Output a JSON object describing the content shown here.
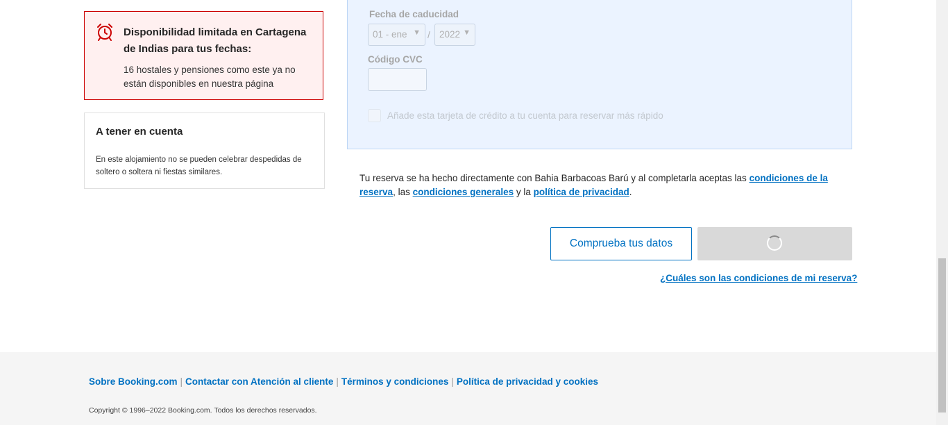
{
  "alert": {
    "icon": "alarm-clock-icon",
    "title": "Disponibilidad limitada en Cartagena de Indias para tus fechas:",
    "text": "16 hostales y pensiones como este ya no están disponibles en nuestra página",
    "color": "#cc0000"
  },
  "notice": {
    "title": "A tener en cuenta",
    "text": "En este alojamiento no se pueden celebrar despedidas de soltero o soltera ni fiestas similares."
  },
  "payment": {
    "expiry_label": "Fecha de caducidad",
    "month_value": "01 - ene",
    "year_value": "2022",
    "separator": "/",
    "cvc_label": "Código CVC",
    "save_card_label": "Añade esta tarjeta de crédito a tu cuenta para reservar más rápido"
  },
  "terms": {
    "prefix": "Tu reserva se ha hecho directamente con Bahia Barbacoas Barú y al completarla aceptas las ",
    "link_booking": "condiciones de la reserva",
    "mid1": ", las ",
    "link_general": "condiciones generales",
    "mid2": " y la ",
    "link_privacy": "política de privacidad",
    "suffix": "."
  },
  "actions": {
    "check_label": "Comprueba tus datos",
    "conditions_link": "¿Cuáles son las condiciones de mi reserva?"
  },
  "footer": {
    "links": [
      "Sobre Booking.com",
      "Contactar con Atención al cliente",
      "Términos y condiciones",
      "Política de privacidad y cookies"
    ],
    "separator": "|",
    "copyright": "Copyright © 1996–2022 Booking.com. Todos los derechos reservados."
  },
  "colors": {
    "link": "#0071c2",
    "alert_border": "#cc0000",
    "alert_bg": "#fff0f0"
  }
}
